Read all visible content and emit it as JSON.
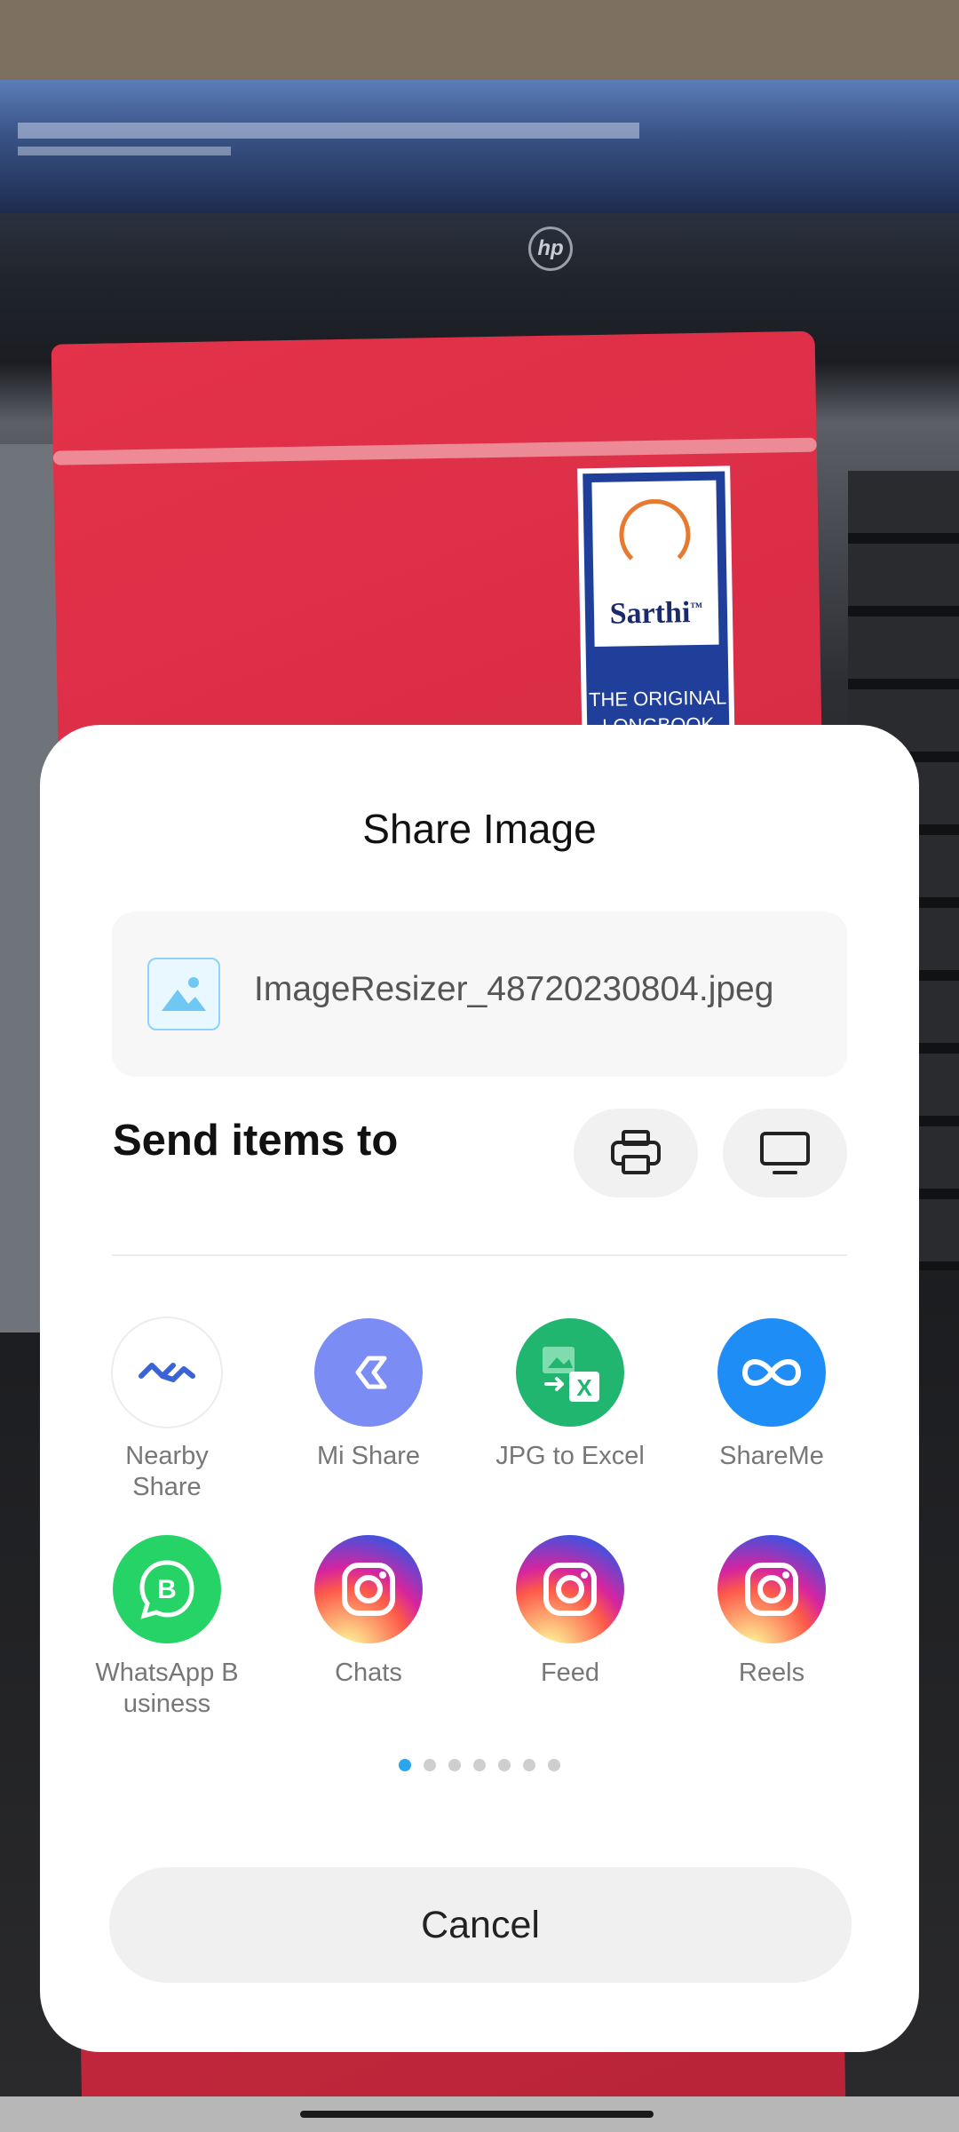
{
  "sheet": {
    "title": "Share Image",
    "file_name": "ImageResizer_48720230804.jpeg",
    "send_label": "Send items to"
  },
  "apps_row1": [
    {
      "label": "Nearby\nShare",
      "icon": "nearby-share-icon"
    },
    {
      "label": "Mi Share",
      "icon": "mi-share-icon"
    },
    {
      "label": "JPG to Excel",
      "icon": "jpg-to-excel-icon"
    },
    {
      "label": "ShareMe",
      "icon": "shareme-icon"
    }
  ],
  "apps_row2": [
    {
      "label": "WhatsApp B\nusiness",
      "icon": "whatsapp-business-icon"
    },
    {
      "label": "Chats",
      "icon": "instagram-icon"
    },
    {
      "label": "Feed",
      "icon": "instagram-icon"
    },
    {
      "label": "Reels",
      "icon": "instagram-icon"
    }
  ],
  "pager": {
    "pages": 7,
    "active": 1
  },
  "cancel_label": "Cancel",
  "background_photo": {
    "book_brand": "Sarthi",
    "book_trademark": "™",
    "book_subtitle": "THE ORIGINAL\nLONGBOOK",
    "laptop_logo": "hp"
  },
  "colors": {
    "accent": "#2aa6ee",
    "mi_share": "#7b8cf5",
    "jpg_excel": "#21b66f",
    "shareme": "#1e8df5",
    "whatsapp": "#25d366"
  }
}
